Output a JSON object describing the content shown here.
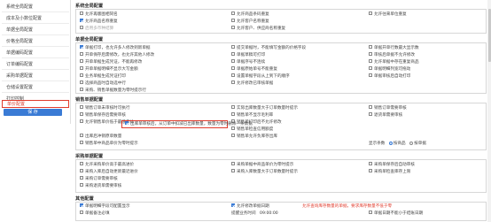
{
  "sidebar": {
    "items": [
      {
        "label": "系统全局配置"
      },
      {
        "label": "成本及小数位配置"
      },
      {
        "label": "单据全局配置"
      },
      {
        "label": "价格全局配置"
      },
      {
        "label": "单据编码配置"
      },
      {
        "label": "订单编码配置"
      },
      {
        "label": "采购单据配置"
      },
      {
        "label": "仓储设置配置"
      },
      {
        "label": "打印控制"
      },
      {
        "label": "单价配置"
      }
    ],
    "save_label": "保 存"
  },
  "sections": {
    "system": {
      "title": "系统全局配置",
      "options": [
        {
          "label": "允许再版图相同名",
          "checked": false
        },
        {
          "label": "允许商品名称重复",
          "checked": true
        },
        {
          "label": "启用多币种结算",
          "checked": false
        },
        {
          "label": "允许商品条码重复",
          "checked": false
        },
        {
          "label": "允许客户名称重复",
          "checked": false
        },
        {
          "label": "允许客户、供应商名称重复",
          "checked": false
        },
        {
          "label": "允许往来单位重复",
          "checked": false
        }
      ]
    },
    "bill_global": {
      "title": "单据全局配置",
      "options": [
        {
          "label": "单据打印，也允许多人修改到新单据",
          "checked": true
        },
        {
          "label": "开单保存后需修改，也允许其他人修改",
          "checked": false
        },
        {
          "label": "开单单据生成凭证，不能再修改",
          "checked": false
        },
        {
          "label": "开单单据明细不显示大写金额",
          "checked": false
        },
        {
          "label": "业务单据生成凭证打印",
          "checked": false
        },
        {
          "label": "选择商品时自动选中行",
          "checked": false
        },
        {
          "label": "采购、销售单据数量为零时提示行",
          "checked": false
        },
        {
          "label": "提交单据时，不能填写金额的价格字段",
          "checked": false
        },
        {
          "label": "单据草稿可打印",
          "checked": false
        },
        {
          "label": "单据序号不连续",
          "checked": false
        },
        {
          "label": "单据原始单号不能重复",
          "checked": false
        },
        {
          "label": "设置单据字段从上到下的顺序",
          "checked": false
        },
        {
          "label": "允许修改已审核单据",
          "checked": false
        },
        {
          "label": "单据开单行数最大显示数",
          "checked": false
        },
        {
          "label": "审核后单据不允许修改",
          "checked": false
        },
        {
          "label": "允许单据中存在重复商品",
          "checked": false
        },
        {
          "label": "单据明细列宽可拖动",
          "checked": false
        },
        {
          "label": "单据审核后自动打印",
          "checked": false
        }
      ]
    },
    "sales": {
      "title": "销售单据配置",
      "options": [
        {
          "label": "销售订单未审核时可执行",
          "checked": false
        },
        {
          "label": "销售单保存后需要审核",
          "checked": false
        },
        {
          "label": "允许销售单价低于最低售价",
          "checked": false
        },
        {
          "label": "出库后冲销原单数量",
          "checked": false
        },
        {
          "label": "销售单中商品单价为零时提示",
          "checked": false
        },
        {
          "label": "实际出库数量大于订单数量时提示",
          "checked": false
        },
        {
          "label": "销售单不显示毛利率",
          "checked": false
        },
        {
          "label": "销售单打印后不允许修改",
          "checked": false
        },
        {
          "label": "销售单检查信用额度",
          "checked": false
        },
        {
          "label": "销售单允许负库存出库",
          "checked": false
        },
        {
          "label": "销售订单需要审核",
          "checked": false
        },
        {
          "label": "退货单需要审核",
          "checked": false
        }
      ],
      "highlight_label": "出库单审核后，从订单中扣减已出库数量，数量为零时删除一条数据"
    },
    "purchase": {
      "title": "采购单据配置",
      "options": [
        {
          "label": "允许采购单价高于最高进价",
          "checked": false
        },
        {
          "label": "采购入库后自动更新最近进价",
          "checked": false
        },
        {
          "label": "采购订单需要审核",
          "checked": false
        },
        {
          "label": "采购退货单需要审核",
          "checked": false
        },
        {
          "label": "采购单据中商品单价为零时提示",
          "checked": false
        },
        {
          "label": "采购入库数量大于订单数量时提示",
          "checked": false
        },
        {
          "label": "采购单保存后自动审核",
          "checked": false
        },
        {
          "label": "采购单检查库存上限",
          "checked": false
        }
      ]
    },
    "other": {
      "title": "其他配置",
      "options": [
        {
          "label": "单据明细字段可配置显示",
          "checked": true
        },
        {
          "label": "单据备注必填",
          "checked": false
        },
        {
          "label": "允许修改单据日期",
          "checked": true
        },
        {
          "label": "单据日期不能小于结账日期",
          "checked": false
        }
      ],
      "red_note": "允许查询库存数量的单据，要求库存数量不低于零",
      "time_label": "提醒业务时间",
      "time_value": "09:00:00",
      "count_label": "显示条数",
      "radio_labels": [
        "按商品",
        "按单据"
      ]
    }
  }
}
